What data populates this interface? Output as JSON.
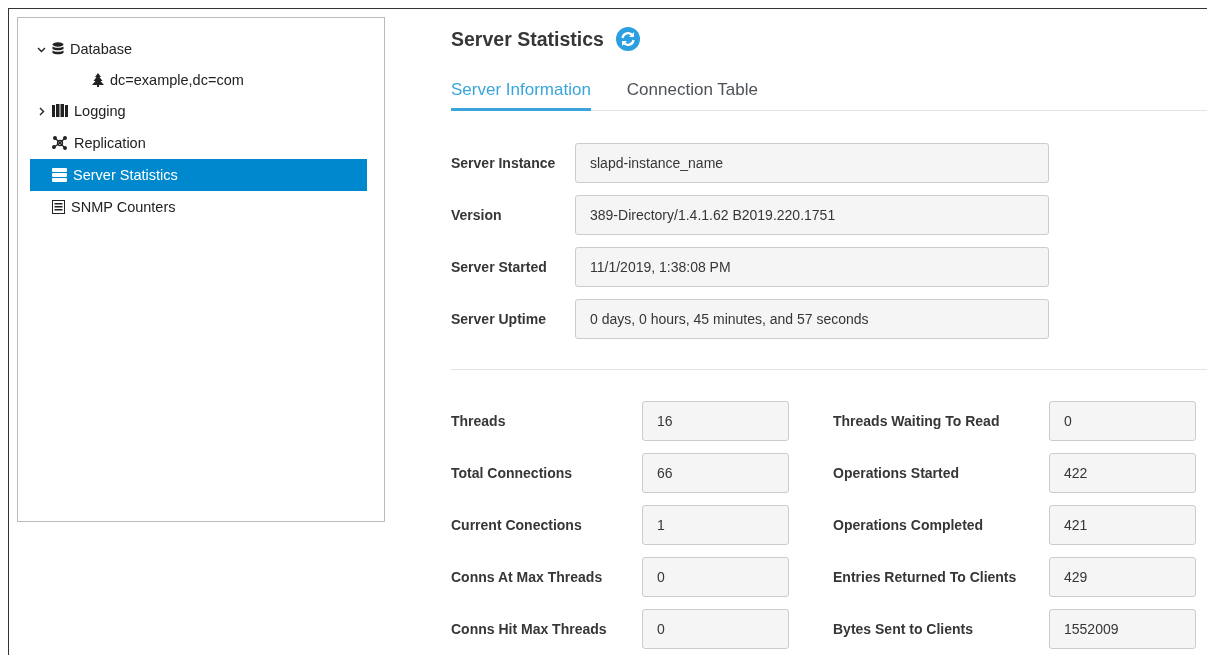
{
  "tree": {
    "items": [
      {
        "label": "Database",
        "kind": "branch",
        "expanded": true,
        "selected": false,
        "children": [
          {
            "label": "dc=example,dc=com",
            "selected": false
          }
        ]
      },
      {
        "label": "Logging",
        "kind": "branch",
        "expanded": false,
        "selected": false
      },
      {
        "label": "Replication",
        "kind": "leaf",
        "selected": false
      },
      {
        "label": "Server Statistics",
        "kind": "leaf",
        "selected": true
      },
      {
        "label": "SNMP Counters",
        "kind": "leaf",
        "selected": false
      }
    ]
  },
  "page": {
    "title": "Server Statistics",
    "tabs": [
      {
        "label": "Server Information",
        "selected": true
      },
      {
        "label": "Connection Table",
        "selected": false
      }
    ],
    "info": [
      {
        "label": "Server Instance",
        "value": "slapd-instance_name"
      },
      {
        "label": "Version",
        "value": "389-Directory/1.4.1.62 B2019.220.1751"
      },
      {
        "label": "Server Started",
        "value": "11/1/2019, 1:38:08 PM"
      },
      {
        "label": "Server Uptime",
        "value": "0 days, 0 hours, 45 minutes, and 57 seconds"
      }
    ],
    "stats": [
      {
        "label": "Threads",
        "value": "16"
      },
      {
        "label": "Threads Waiting To Read",
        "value": "0"
      },
      {
        "label": "Total Connections",
        "value": "66"
      },
      {
        "label": "Operations Started",
        "value": "422"
      },
      {
        "label": "Current Conections",
        "value": "1"
      },
      {
        "label": "Operations Completed",
        "value": "421"
      },
      {
        "label": "Conns At Max Threads",
        "value": "0"
      },
      {
        "label": "Entries Returned To Clients",
        "value": "429"
      },
      {
        "label": "Conns Hit Max Threads",
        "value": "0"
      },
      {
        "label": "Bytes Sent to Clients",
        "value": "1552009"
      }
    ]
  }
}
